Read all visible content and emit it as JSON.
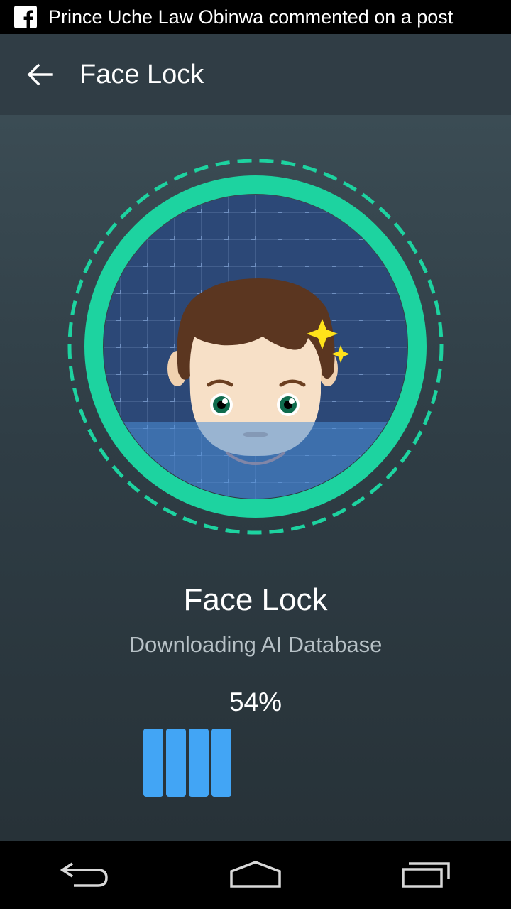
{
  "status_bar": {
    "notification_icon": "facebook-icon",
    "notification_text": "Prince Uche Law Obinwa commented on a post"
  },
  "app_bar": {
    "back_icon": "back-arrow-icon",
    "title": "Face Lock"
  },
  "main": {
    "illustration": "face-scan-illustration",
    "title": "Face Lock",
    "subtitle": "Downloading AI Database",
    "progress_label": "54%",
    "progress_value": 0.54,
    "progress_segments_filled": 4,
    "accent_color": "#1dd3a0",
    "progress_color": "#42a5f5"
  },
  "nav_bar": {
    "back_icon": "nav-back-icon",
    "home_icon": "nav-home-icon",
    "recents_icon": "nav-recents-icon"
  }
}
